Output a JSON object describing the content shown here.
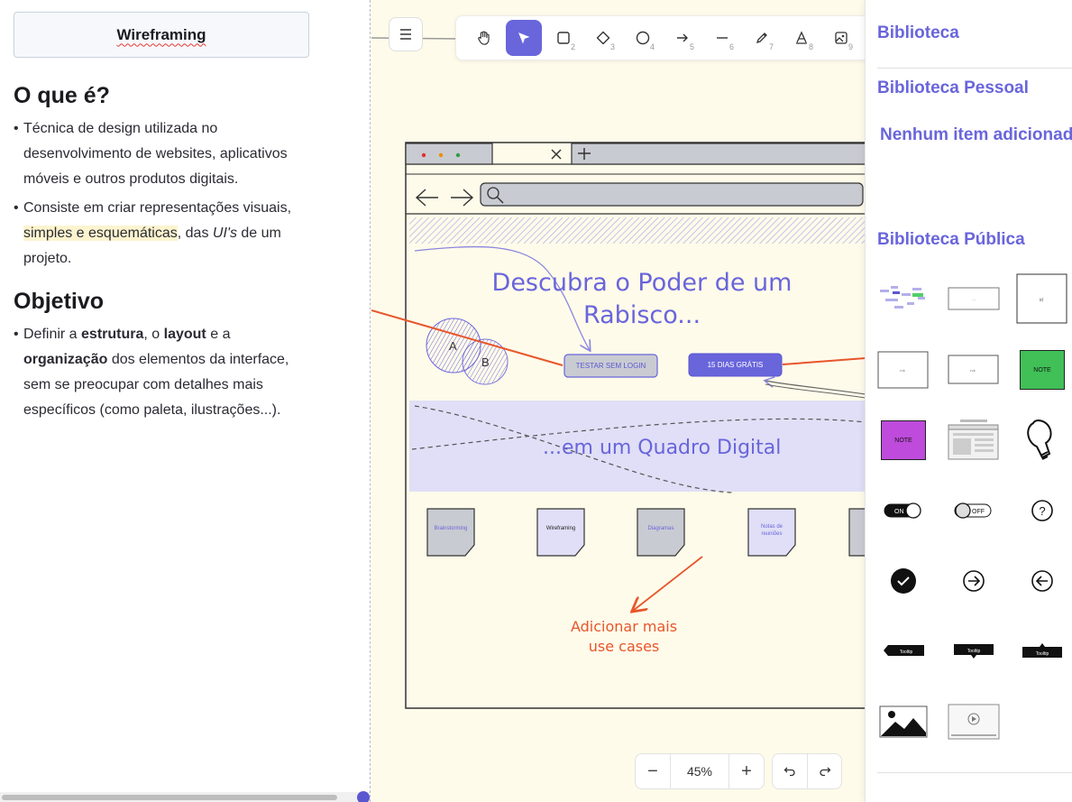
{
  "notes": {
    "title": "Wireframing",
    "section1": {
      "heading": "O que é?",
      "bullet1": "Técnica de design utilizada no desenvolvimento de websites, aplicativos móveis e outros produtos digitais.",
      "bullet2_start": "Consiste em criar representações visuais,",
      "bullet2_highlight": "simples e esquemáticas",
      "bullet2_mid": ", das",
      "bullet2_em": "UI's",
      "bullet2_end": "de um projeto."
    },
    "section2": {
      "heading": "Objetivo",
      "b_pre": "Definir a",
      "b_strong1": "estrutura",
      "b_sep1": ", o",
      "b_strong2": "layout",
      "b_sep2": "e a",
      "b_strong3": "organização",
      "b_end": "dos elementos da interface, sem se preocupar com detalhes mais específicos (como paleta, ilustrações...)."
    }
  },
  "toolbar": {
    "tools": [
      {
        "icon": "hand-icon",
        "num": ""
      },
      {
        "icon": "pointer-icon",
        "num": ""
      },
      {
        "icon": "rectangle-icon",
        "num": "2"
      },
      {
        "icon": "diamond-icon",
        "num": "3"
      },
      {
        "icon": "ellipse-icon",
        "num": "4"
      },
      {
        "icon": "arrow-icon",
        "num": "5"
      },
      {
        "icon": "line-icon",
        "num": "6"
      },
      {
        "icon": "pencil-icon",
        "num": "7"
      },
      {
        "icon": "text-icon",
        "num": "8"
      },
      {
        "icon": "image-icon",
        "num": "9"
      }
    ],
    "accent": "#6965db"
  },
  "canvas": {
    "headline_line1": "Descubra o Poder de um",
    "headline_line2": "Rabisco...",
    "btn_try": "TESTAR SEM LOGIN",
    "btn_trial": "15 DIAS GRÁTIS",
    "venn_a": "A",
    "venn_b": "B",
    "band_text": "...em um Quadro Digital",
    "notes": [
      "Brainstorming",
      "Wireframing",
      "Diagramas",
      "Notas de reuniões"
    ],
    "add_more_line1": "Adicionar mais",
    "add_more_line2": "use cases",
    "zoom": "45%",
    "zoom_out": "−",
    "zoom_in": "+"
  },
  "library": {
    "title": "Biblioteca",
    "personal": "Biblioteca Pessoal",
    "empty": "Nenhum item adicionado",
    "public": "Biblioteca Pública",
    "items": {
      "note_label": "NOTE",
      "toggle_on": "ON",
      "toggle_off": "OFF",
      "tooltip": "Tooltip"
    }
  }
}
